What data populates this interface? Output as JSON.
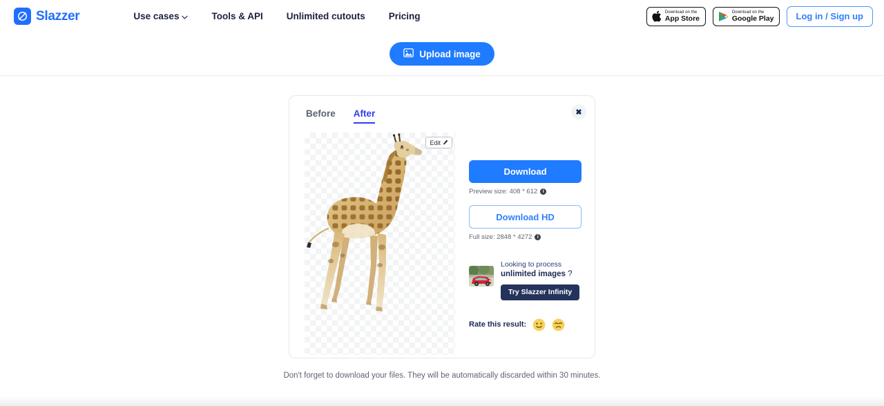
{
  "header": {
    "logo": {
      "text": "Slazzer",
      "icon": "slazzer-logo-icon"
    },
    "nav": [
      {
        "label": "Use cases",
        "has_chevron": true
      },
      {
        "label": "Tools & API",
        "has_chevron": false
      },
      {
        "label": "Unlimited cutouts",
        "has_chevron": false
      },
      {
        "label": "Pricing",
        "has_chevron": false
      }
    ],
    "chevron": "∨",
    "app_store": {
      "small": "Download on the",
      "big": "App Store"
    },
    "google_play": {
      "small": "Download on the",
      "big": "Google Play"
    },
    "login_label": "Log in / Sign up"
  },
  "upload": {
    "label": "Upload image",
    "icon": "image-icon"
  },
  "card": {
    "close_label": "✖",
    "tabs": [
      {
        "label": "Before",
        "active": false
      },
      {
        "label": "After",
        "active": true
      }
    ],
    "edit_label": "Edit",
    "edit_icon": "✎",
    "download_label": "Download",
    "preview_size": "Preview size: 408 * 612",
    "download_hd_label": "Download HD",
    "full_size": "Full size: 2848 * 4272",
    "info_glyph": "i",
    "promo": {
      "line1": "Looking to process",
      "line2_strong": "unlimited images",
      "line2_suffix": "?",
      "button_label": "Try Slazzer Infinity"
    },
    "rate": {
      "label": "Rate this result:",
      "positive_icon": "slightly-smiling-face",
      "negative_icon": "disappointed-face"
    }
  },
  "footer": {
    "note": "Don't forget to download your files. They will be automatically discarded within 30 minutes."
  },
  "colors": {
    "brand_blue": "#1f7bff",
    "tab_active": "#2d3df0",
    "navy": "#24335c",
    "emoji_yellow": "#f7d15a"
  }
}
